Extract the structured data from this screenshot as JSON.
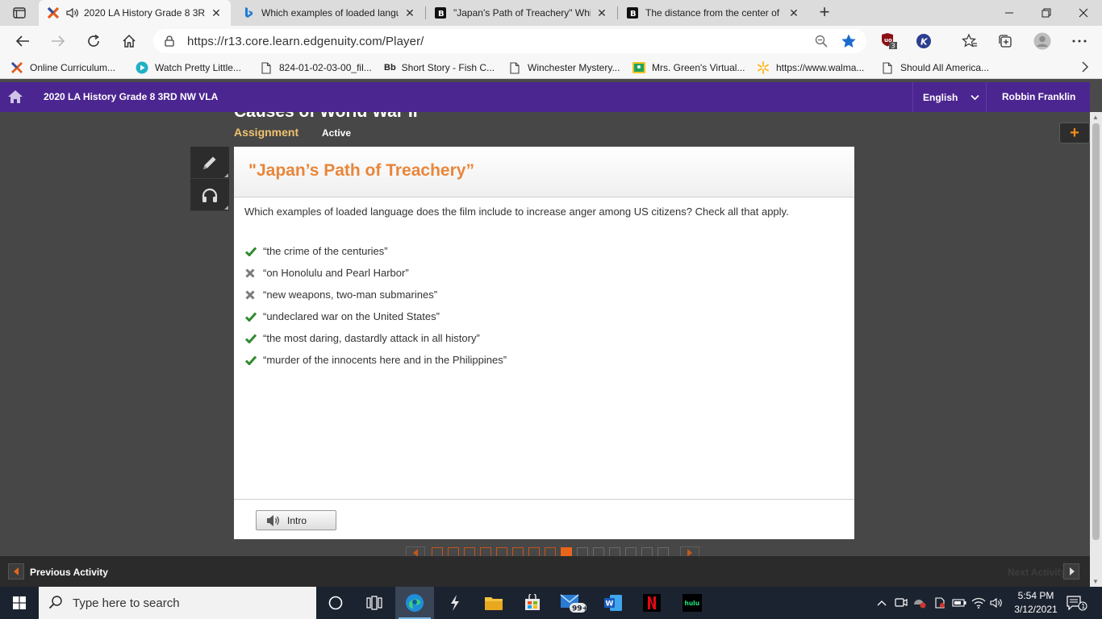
{
  "browser": {
    "tabs": [
      {
        "title": "2020 LA History Grade 8 3R",
        "favicon": "edgenuity-x-icon",
        "active": true,
        "audio": true
      },
      {
        "title": "Which examples of loaded langu",
        "favicon": "bing-icon",
        "active": false
      },
      {
        "title": "\"Japan's Path of Treachery\" Whic",
        "favicon": "brainly-icon",
        "active": false
      },
      {
        "title": "The distance from the center of c",
        "favicon": "brainly-icon",
        "active": false
      }
    ],
    "url": "https://r13.core.learn.edgenuity.com/Player/",
    "extension_badge": "3",
    "bookmarks": [
      {
        "label": "Online Curriculum..."
      },
      {
        "label": "Watch Pretty Little..."
      },
      {
        "label": "824-01-02-03-00_fil..."
      },
      {
        "label": "Short Story - Fish C...",
        "prefix": "Bb"
      },
      {
        "label": "Winchester Mystery..."
      },
      {
        "label": "Mrs. Green's Virtual..."
      },
      {
        "label": "https://www.walma..."
      },
      {
        "label": "Should All America..."
      }
    ]
  },
  "header": {
    "course": "2020 LA History Grade 8 3RD NW VLA",
    "language": "English",
    "user": "Robbin Franklin"
  },
  "lesson": {
    "title": "Causes of World War II",
    "type": "Assignment",
    "status": "Active"
  },
  "question": {
    "heading": "\"Japan’s Path of Treachery”",
    "prompt": "Which examples of loaded language does the film include to increase anger among US citizens? Check all that apply.",
    "answers": [
      {
        "text": "“the crime of the centuries”",
        "mark": "correct"
      },
      {
        "text": "“on Honolulu and Pearl Harbor”",
        "mark": "incorrect"
      },
      {
        "text": "“new weapons, two-man submarines”",
        "mark": "incorrect"
      },
      {
        "text": "“undeclared war on the United States”",
        "mark": "correct"
      },
      {
        "text": "“the most daring, dastardly attack in all history”",
        "mark": "correct"
      },
      {
        "text": "“murder of the innocents here and in the Philippines”",
        "mark": "correct"
      }
    ],
    "intro_label": "Intro"
  },
  "pager": {
    "total": 15,
    "current": 9
  },
  "activity_nav": {
    "previous": "Previous Activity",
    "next": "Next Activity"
  },
  "taskbar": {
    "search_placeholder": "Type here to search",
    "mail_badge": "99+",
    "time": "5:54 PM",
    "date": "3/12/2021",
    "notification_count": "1"
  },
  "colors": {
    "header_purple": "#4b2590",
    "heading_orange": "#e8863a",
    "correct_green": "#2e8b2e",
    "incorrect_gray": "#7a7a7a",
    "pager_current": "#e8661a"
  }
}
